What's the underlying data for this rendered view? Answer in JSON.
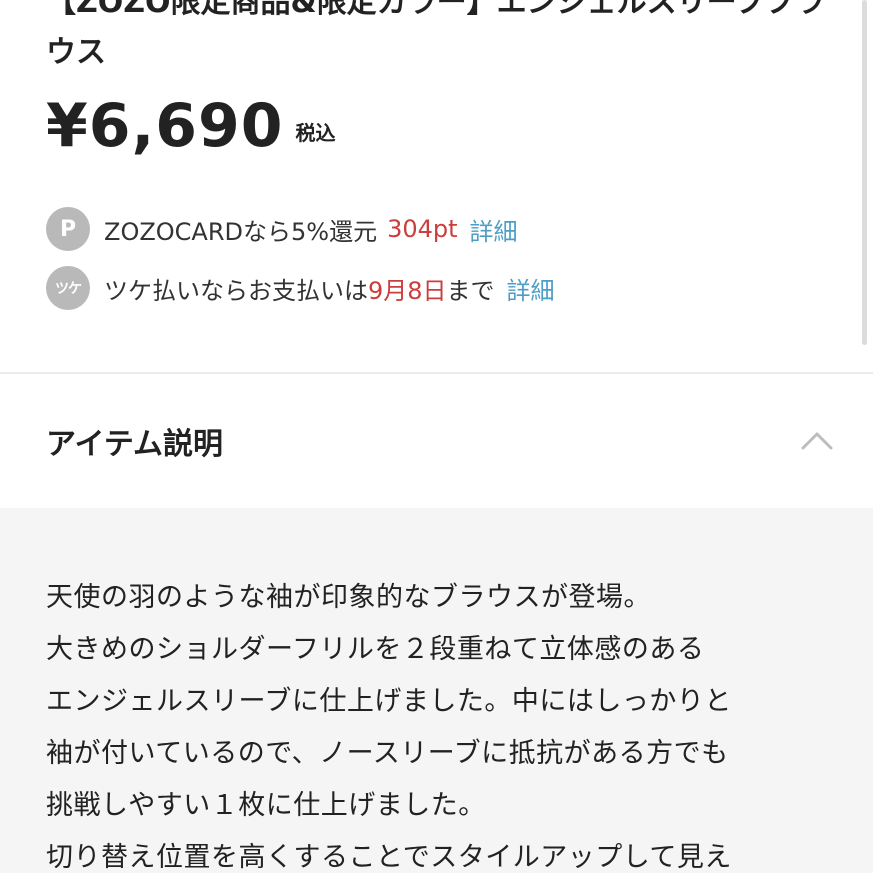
{
  "product": {
    "title": "【ZOZO限定商品&限定カラー】エンジェルスリーブブラウス",
    "price": "¥6,690",
    "tax_label": "税込"
  },
  "benefits": {
    "zozocard": {
      "icon": "P",
      "text": "ZOZOCARDなら5%還元",
      "points": "304pt",
      "link": "詳細"
    },
    "tsuke": {
      "icon": "ツケ",
      "text_before": "ツケ払いならお支払いは",
      "date": "9月8日",
      "text_after": "まで",
      "link": "詳細"
    }
  },
  "section": {
    "title": "アイテム説明"
  },
  "description": {
    "lines": [
      "天使の羽のような袖が印象的なブラウスが登場。",
      "大きめのショルダーフリルを２段重ねて立体感のある",
      "エンジェルスリーブに仕上げました。中にはしっかりと",
      "袖が付いているので、ノースリーブに抵抗がある方でも",
      "挑戦しやすい１枚に仕上げました。",
      "切り替え位置を高くすることでスタイルアップして見え"
    ]
  },
  "colors": {
    "accent_red": "#cc3d3d",
    "link_blue": "#4d9ec6",
    "icon_gray": "#b9b9b9",
    "description_bg": "#f5f5f5"
  }
}
